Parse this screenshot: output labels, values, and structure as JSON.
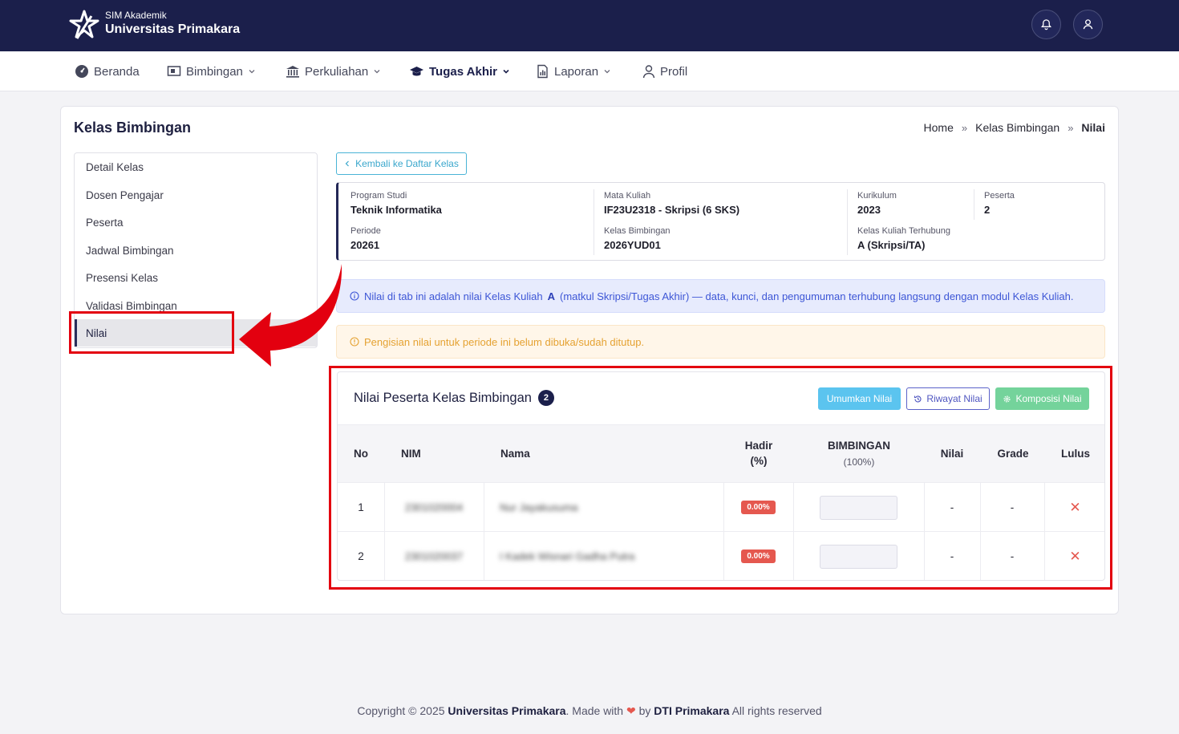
{
  "header": {
    "app_label": "SIM Akademik",
    "university": "Universitas Primakara"
  },
  "nav": {
    "items": [
      {
        "label": "Beranda",
        "icon": "dashboard-icon"
      },
      {
        "label": "Bimbingan",
        "icon": "presentation-icon"
      },
      {
        "label": "Perkuliahan",
        "icon": "institution-icon"
      },
      {
        "label": "Tugas Akhir",
        "icon": "graduation-cap-icon"
      },
      {
        "label": "Laporan",
        "icon": "report-icon"
      },
      {
        "label": "Profil",
        "icon": "user-icon"
      }
    ],
    "active": "Tugas Akhir"
  },
  "page": {
    "title": "Kelas Bimbingan",
    "breadcrumb": [
      "Home",
      "Kelas Bimbingan",
      "Nilai"
    ],
    "breadcrumb_sep": "»"
  },
  "sidebar": {
    "items": [
      {
        "label": "Detail Kelas"
      },
      {
        "label": "Dosen Pengajar"
      },
      {
        "label": "Peserta"
      },
      {
        "label": "Jadwal Bimbingan"
      },
      {
        "label": "Presensi Kelas"
      },
      {
        "label": "Validasi Bimbingan"
      },
      {
        "label": "Nilai"
      }
    ],
    "active": "Nilai"
  },
  "back_button": "Kembali ke Daftar Kelas",
  "info": {
    "program_studi": {
      "label": "Program Studi",
      "value": "Teknik Informatika"
    },
    "mata_kuliah": {
      "label": "Mata Kuliah",
      "value": "IF23U2318 - Skripsi (6 SKS)"
    },
    "kurikulum": {
      "label": "Kurikulum",
      "value": "2023"
    },
    "peserta": {
      "label": "Peserta",
      "value": "2"
    },
    "periode": {
      "label": "Periode",
      "value": "20261"
    },
    "kelas_bimbingan": {
      "label": "Kelas Bimbingan",
      "value": "2026YUD01"
    },
    "kelas_kuliah": {
      "label": "Kelas Kuliah Terhubung",
      "value": "A (Skripsi/TA)"
    }
  },
  "alerts": {
    "info_pre": "Nilai di tab ini adalah nilai Kelas Kuliah",
    "info_bold": "A",
    "info_post": "(matkul Skripsi/Tugas Akhir) — data, kunci, dan pengumuman terhubung langsung dengan modul Kelas Kuliah.",
    "warning": "Pengisian nilai untuk periode ini belum dibuka/sudah ditutup."
  },
  "grades": {
    "title": "Nilai Peserta Kelas Bimbingan",
    "count": "2",
    "buttons": {
      "umumkan": "Umumkan Nilai",
      "riwayat": "Riwayat Nilai",
      "komposisi": "Komposisi Nilai"
    },
    "columns": {
      "no": "No",
      "nim": "NIM",
      "nama": "Nama",
      "hadir": "Hadir",
      "hadir_sub": "(%)",
      "bimbingan": "BIMBINGAN",
      "bimbingan_sub": "(100%)",
      "nilai": "Nilai",
      "grade": "Grade",
      "lulus": "Lulus"
    },
    "rows": [
      {
        "no": "1",
        "nim": "2301020004",
        "nama": "Nur Jayakusuma",
        "hadir": "0.00%",
        "nilai": "-",
        "grade": "-",
        "lulus": "✕"
      },
      {
        "no": "2",
        "nim": "2301020037",
        "nama": "I Kadek Wisnari Gadha Putra",
        "hadir": "0.00%",
        "nilai": "-",
        "grade": "-",
        "lulus": "✕"
      }
    ]
  },
  "footer": {
    "pre": "Copyright © 2025",
    "org": "Universitas Primakara",
    "made": ". Made with",
    "heart": "❤",
    "by": "by",
    "team": "DTI Primakara",
    "rights": "All rights reserved"
  },
  "colors": {
    "primary": "#1b1f4b",
    "info": "#5bc4ef",
    "success": "#74d39b",
    "danger": "#e5584f",
    "annotation": "#e3000f"
  }
}
